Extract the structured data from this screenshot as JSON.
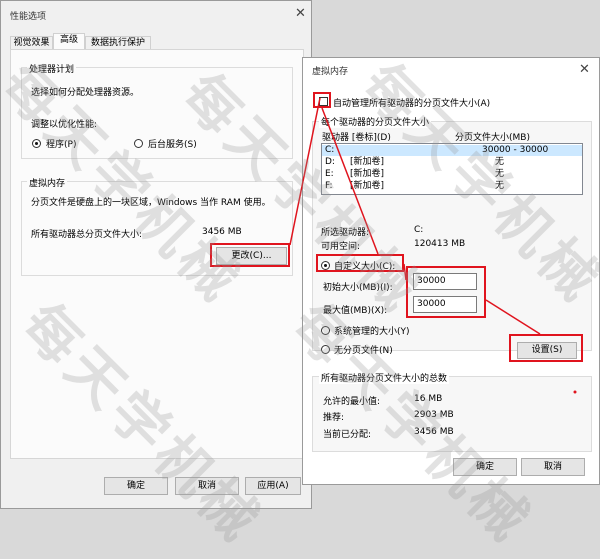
{
  "left_dialog": {
    "title": "性能选项",
    "tabs": [
      "视觉效果",
      "高级",
      "数据执行保护"
    ],
    "processor_group": {
      "label": "处理器计划",
      "desc": "选择如何分配处理器资源。",
      "optimize_label": "调整以优化性能:",
      "radio_programs": "程序(P)",
      "radio_services": "后台服务(S)"
    },
    "vm_group": {
      "label": "虚拟内存",
      "desc": "分页文件是硬盘上的一块区域，Windows 当作 RAM 使用。",
      "total_label": "所有驱动器总分页文件大小:",
      "total_value": "3456 MB",
      "change_button": "更改(C)..."
    },
    "buttons": {
      "ok": "确定",
      "cancel": "取消",
      "apply": "应用(A)"
    }
  },
  "right_dialog": {
    "title": "虚拟内存",
    "auto_manage_label": "自动管理所有驱动器的分页文件大小(A)",
    "per_drive_label": "每个驱动器的分页文件大小",
    "columns": {
      "drive": "驱动器 [卷标](D)",
      "size": "分页文件大小(MB)"
    },
    "drives": [
      {
        "drive": "C:",
        "label": "",
        "size": "30000 - 30000",
        "selected": true
      },
      {
        "drive": "D:",
        "label": "[新加卷]",
        "size": "无",
        "selected": false
      },
      {
        "drive": "E:",
        "label": "[新加卷]",
        "size": "无",
        "selected": false
      },
      {
        "drive": "F:",
        "label": "[新加卷]",
        "size": "无",
        "selected": false
      }
    ],
    "selected_drive_label": "所选驱动器:",
    "selected_drive_value": "C:",
    "free_space_label": "可用空间:",
    "free_space_value": "120413 MB",
    "custom_size_label": "自定义大小(C):",
    "initial_size_label": "初始大小(MB)(I):",
    "initial_size_value": "30000",
    "max_size_label": "最大值(MB)(X):",
    "max_size_value": "30000",
    "system_managed_label": "系统管理的大小(Y)",
    "no_paging_label": "无分页文件(N)",
    "set_button": "设置(S)",
    "totals_label": "所有驱动器分页文件大小的总数",
    "min_allowed_label": "允许的最小值:",
    "min_allowed_value": "16 MB",
    "recommended_label": "推荐:",
    "recommended_value": "2903 MB",
    "current_label": "当前已分配:",
    "current_value": "3456 MB",
    "buttons": {
      "ok": "确定",
      "cancel": "取消"
    }
  },
  "watermark": "每天学机械",
  "colors": {
    "highlight": "#e0141e",
    "selection": "#cce8ff"
  }
}
